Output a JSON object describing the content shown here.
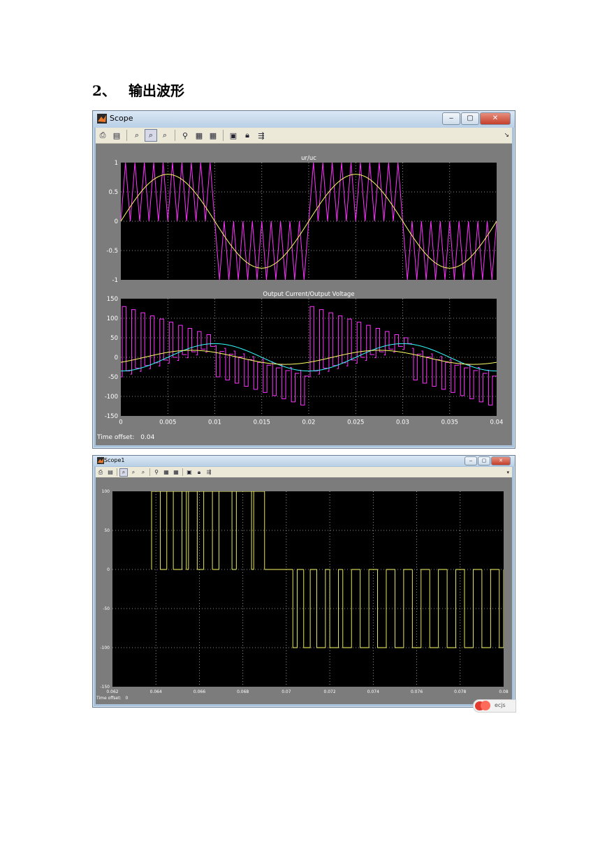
{
  "heading": {
    "number": "2、",
    "text": "输出波形"
  },
  "scope1": {
    "window_title": "Scope",
    "time_offset_label": "Time offset:",
    "time_offset_value": "0.04",
    "toolbar_icons": [
      "print-icon",
      "parameters-icon",
      "zoom-icon",
      "zoom-x-icon",
      "zoom-y-icon",
      "autoscale-icon",
      "save-axes-icon",
      "restore-axes-icon",
      "floating-scope-icon",
      "lock-axes-icon",
      "signal-selection-icon"
    ]
  },
  "scope2": {
    "window_title": "Scope1",
    "time_offset_label": "Time offset:",
    "time_offset_value": "0"
  },
  "watermark": {
    "text": "ecjs"
  },
  "colors": {
    "pwm": "#ff33ff",
    "yellow": "#ffff66",
    "cyan": "#33ffff",
    "plot_bg": "#000000",
    "frame": "#7c7c7c"
  },
  "chart_data": [
    {
      "type": "line",
      "title": "ur/uc",
      "xlim": [
        0,
        0.04
      ],
      "ylim": [
        -1,
        1
      ],
      "x_ticks": [],
      "y_ticks": [
        "1",
        "0.5",
        "0",
        "-0.5",
        "-1"
      ],
      "grid": true,
      "series": [
        {
          "color": "#ffff66",
          "kind": "sine",
          "amplitude": 0.8,
          "frequency_hz": 50
        },
        {
          "color": "#ff33ff",
          "kind": "unipolar-carrier",
          "carrier_hz": 1000
        }
      ]
    },
    {
      "type": "line",
      "title": "Output Current/Output Voltage",
      "xlim": [
        0,
        0.04
      ],
      "ylim": [
        -150,
        150
      ],
      "x_ticks": [
        "0",
        "0.005",
        "0.01",
        "0.015",
        "0.02",
        "0.025",
        "0.03",
        "0.035",
        "0.04"
      ],
      "y_ticks": [
        "150",
        "100",
        "50",
        "0",
        "-50",
        "-100",
        "-150"
      ],
      "grid": true,
      "series": [
        {
          "color": "#ff33ff",
          "kind": "pwm-voltage",
          "envelope_high": 130,
          "envelope_low": 50
        },
        {
          "color": "#33ffff",
          "kind": "sine",
          "amplitude": 50,
          "frequency_hz": 50
        },
        {
          "color": "#ffff66",
          "kind": "sine",
          "amplitude": 18,
          "frequency_hz": 50
        }
      ]
    },
    {
      "type": "line",
      "title": "",
      "xlim": [
        0.062,
        0.08
      ],
      "ylim": [
        -150,
        100
      ],
      "x_ticks": [
        "0.062",
        "0.064",
        "0.066",
        "0.068",
        "0.07",
        "0.072",
        "0.074",
        "0.076",
        "0.078",
        "0.08"
      ],
      "y_ticks": [
        "100",
        "50",
        "0",
        "-50",
        "-100",
        "-150"
      ],
      "grid": true,
      "series": [
        {
          "color": "#ffff66",
          "kind": "pwm-output",
          "high": 100,
          "low": -100
        }
      ]
    }
  ]
}
